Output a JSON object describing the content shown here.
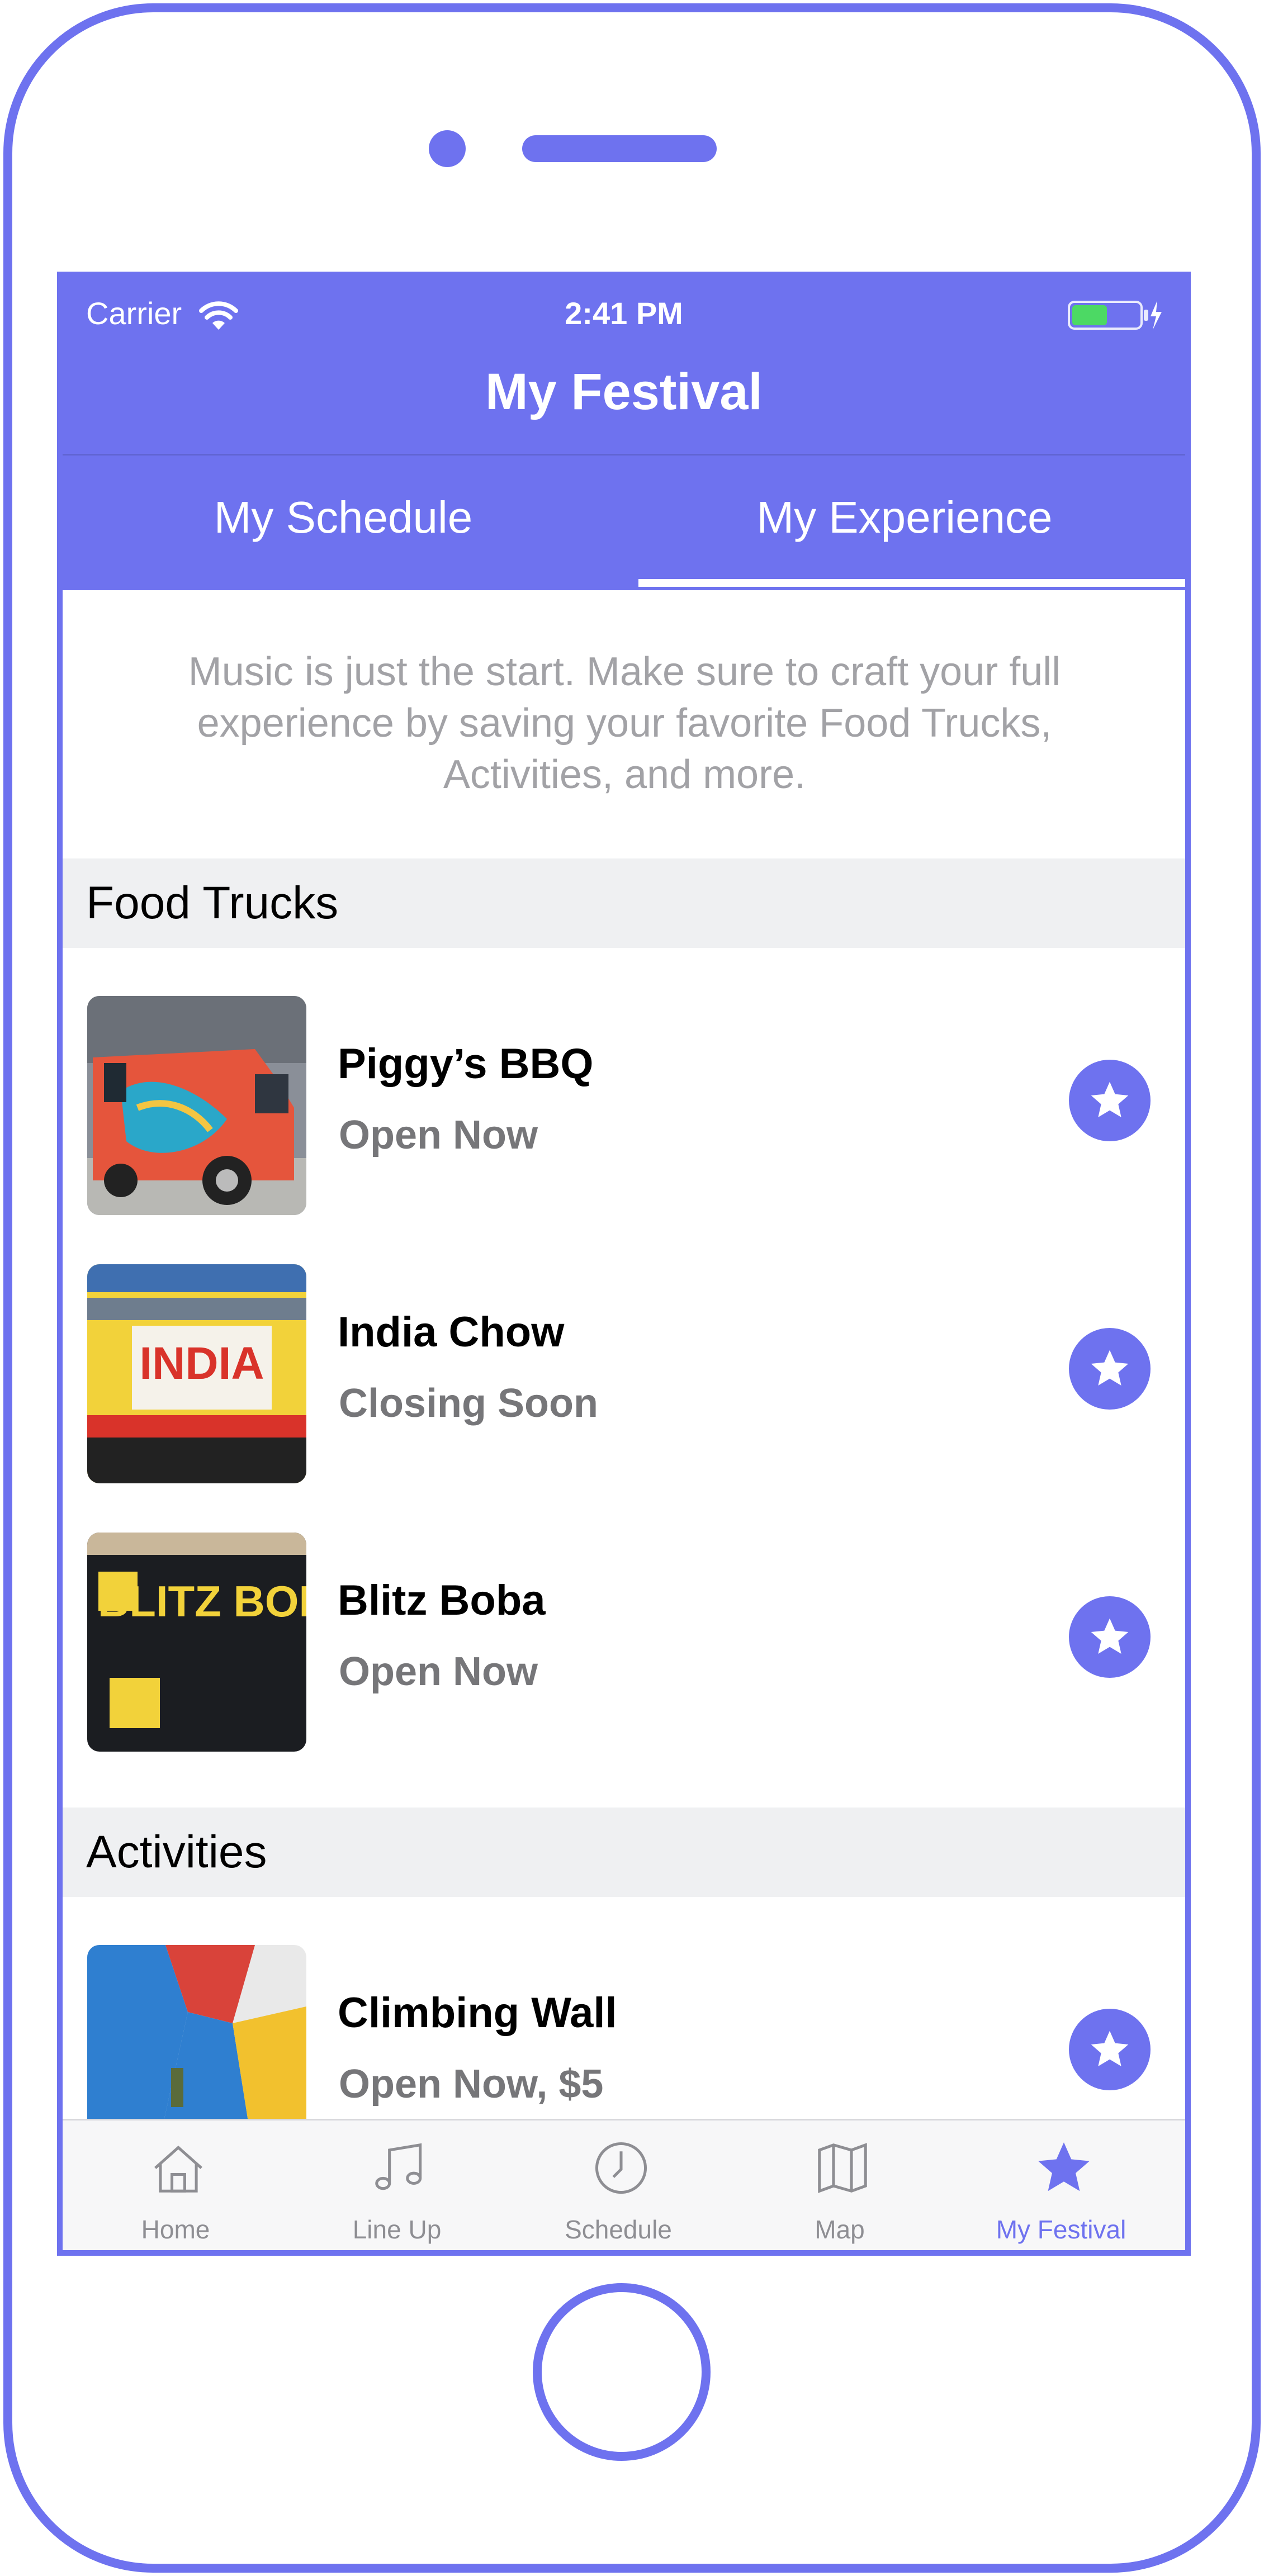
{
  "status_bar": {
    "carrier": "Carrier",
    "time": "2:41 PM"
  },
  "nav": {
    "title": "My Festival"
  },
  "segments": [
    {
      "label": "My Schedule",
      "selected": false
    },
    {
      "label": "My Experience",
      "selected": true
    }
  ],
  "intro_text": "Music is just the start. Make sure to craft your full experience by saving your favorite Food Trucks, Activities, and more.",
  "sections": [
    {
      "title": "Food Trucks",
      "items": [
        {
          "name": "Piggy’s BBQ",
          "status": "Open Now",
          "image": "food-truck-red"
        },
        {
          "name": "India Chow",
          "status": "Closing Soon",
          "image": "food-truck-india",
          "image_text": "INDIA"
        },
        {
          "name": "Blitz Boba",
          "status": "Open Now",
          "image": "food-truck-boba",
          "image_text": "BLITZ BOBA"
        }
      ]
    },
    {
      "title": "Activities",
      "items": [
        {
          "name": "Climbing Wall",
          "status": "Open Now, $5",
          "image": "climbing-wall"
        }
      ]
    }
  ],
  "tabbar": [
    {
      "label": "Home",
      "icon": "home-icon"
    },
    {
      "label": "Line Up",
      "icon": "music-note-icon"
    },
    {
      "label": "Schedule",
      "icon": "clock-icon"
    },
    {
      "label": "Map",
      "icon": "map-icon"
    },
    {
      "label": "My Festival",
      "icon": "star-icon",
      "active": true
    }
  ],
  "colors": {
    "accent": "#6e72ef",
    "inactive": "#8e8e93",
    "section_bg": "#eff0f2"
  }
}
